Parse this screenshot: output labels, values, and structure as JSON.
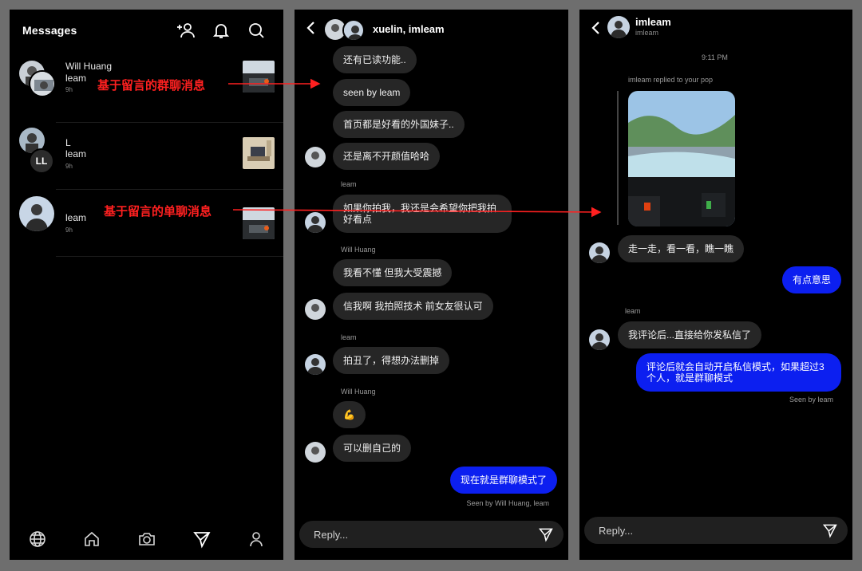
{
  "list_panel": {
    "title": "Messages",
    "icons": [
      "add-person-icon",
      "bell-icon",
      "search-icon"
    ],
    "conversations": [
      {
        "name": "Will Huang",
        "sender": "leam",
        "time": "9h"
      },
      {
        "name": "L",
        "sender": "leam",
        "time": "9h",
        "initials": "LL"
      },
      {
        "name": "leam",
        "sender": "",
        "time": "9h"
      }
    ],
    "nav_icons": [
      "globe-icon",
      "home-icon",
      "camera-icon",
      "send-icon",
      "profile-icon"
    ]
  },
  "annotations": {
    "group_label": "基于留言的群聊消息",
    "single_label": "基于留言的单聊消息",
    "color": "#ff2020"
  },
  "group_chat": {
    "title": "xuelin, imleam",
    "messages": [
      {
        "text": "还有已读功能.."
      },
      {
        "text": "seen by leam"
      },
      {
        "text": "首页都是好看的外国妹子.."
      },
      {
        "text": "还是离不开颜值哈哈"
      },
      {
        "sender_label": "leam",
        "text": "如果你拍我，我还是会希望你把我拍好看点"
      },
      {
        "sender_label": "Will Huang",
        "text": "我看不懂 但我大受震撼"
      },
      {
        "text": "信我啊 我拍照技术 前女友很认可"
      },
      {
        "sender_label": "leam",
        "text": "拍丑了，得想办法删掉"
      },
      {
        "sender_label": "Will Huang",
        "text": "💪"
      },
      {
        "text": "可以删自己的"
      },
      {
        "text": "现在就是群聊模式了",
        "mine": true
      }
    ],
    "seen_text": "Seen by Will Huang, leam",
    "reply_placeholder": "Reply..."
  },
  "single_chat": {
    "title": "imleam",
    "subtitle": "imleam",
    "timestamp": "9:11 PM",
    "story_reply_label": "imleam replied to your pop",
    "messages": [
      {
        "text": "走一走，看一看，瞧一瞧"
      },
      {
        "text": "有点意思",
        "mine": true
      },
      {
        "sender_label": "leam",
        "text": "我评论后...直接给你发私信了"
      },
      {
        "text": "评论后就会自动开启私信模式，如果超过3个人，就是群聊模式",
        "mine": true
      }
    ],
    "seen_text": "Seen by leam",
    "reply_placeholder": "Reply..."
  },
  "colors": {
    "outgoing_bubble": "#0c1ff0",
    "incoming_bubble": "#262626",
    "background": "#000000",
    "frame": "#6e6e6e"
  }
}
